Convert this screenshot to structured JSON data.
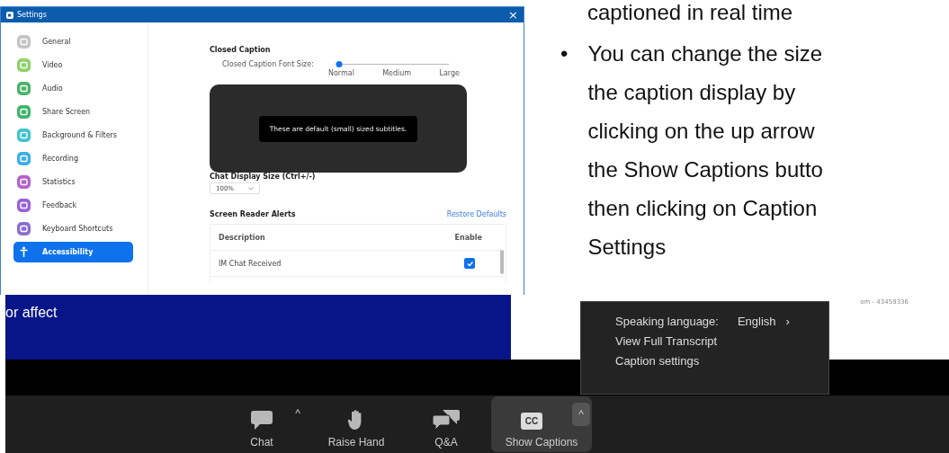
{
  "settings_window": {
    "title": "Settings",
    "close": "×",
    "sidebar": {
      "items": [
        {
          "label": "General",
          "color": "#c4c4c4",
          "selected": false
        },
        {
          "label": "Video",
          "color": "#8fd16a",
          "selected": false
        },
        {
          "label": "Audio",
          "color": "#4cb36b",
          "selected": false
        },
        {
          "label": "Share Screen",
          "color": "#3db56b",
          "selected": false
        },
        {
          "label": "Background & Filters",
          "color": "#3fc3cf",
          "selected": false
        },
        {
          "label": "Recording",
          "color": "#3aaee8",
          "selected": false
        },
        {
          "label": "Statistics",
          "color": "#b562c9",
          "selected": false
        },
        {
          "label": "Feedback",
          "color": "#9a61d6",
          "selected": false
        },
        {
          "label": "Keyboard Shortcuts",
          "color": "#8a6fcf",
          "selected": false
        },
        {
          "label": "Accessibility",
          "color": "#ffffff",
          "selected": true
        }
      ]
    },
    "closed_caption": {
      "heading": "Closed Caption",
      "font_size_label": "Closed Caption Font Size:",
      "slider": {
        "level": 0,
        "stops": [
          "Normal",
          "Medium",
          "Large"
        ]
      },
      "preview_text": "These are default (small) sized subtitles."
    },
    "chat_display": {
      "heading": "Chat Display Size (Ctrl+/-)",
      "value": "100%"
    },
    "screen_reader": {
      "heading": "Screen Reader Alerts",
      "restore_link": "Restore Defaults",
      "columns": [
        "Description",
        "Enable"
      ],
      "rows": [
        {
          "description": "IM Chat Received",
          "checked": true
        }
      ]
    }
  },
  "slide_text": {
    "continuation": "captioned in real time",
    "bullet": "•",
    "paragraph": "You can change the size\nthe caption display by\nclicking on the up arrow\nthe Show Captions butto\nthen clicking on Caption\nSettings"
  },
  "meeting": {
    "shared_text": "or affect",
    "meeting_id": "om - 43459336",
    "caption_menu": [
      {
        "kind": "submenu",
        "label": "Speaking language:",
        "value": "English",
        "chevron": "›"
      },
      {
        "kind": "item",
        "label": "View Full Transcript"
      },
      {
        "kind": "item",
        "label": "Caption settings"
      }
    ],
    "toolbar": [
      {
        "kind": "chat",
        "label": "Chat",
        "caret": "^",
        "active": false
      },
      {
        "kind": "hand",
        "label": "Raise Hand",
        "active": false
      },
      {
        "kind": "qa",
        "label": "Q&A",
        "active": false
      },
      {
        "kind": "cc",
        "label": "Show Captions",
        "icon_text": "CC",
        "caret": "^",
        "active": true
      }
    ]
  }
}
